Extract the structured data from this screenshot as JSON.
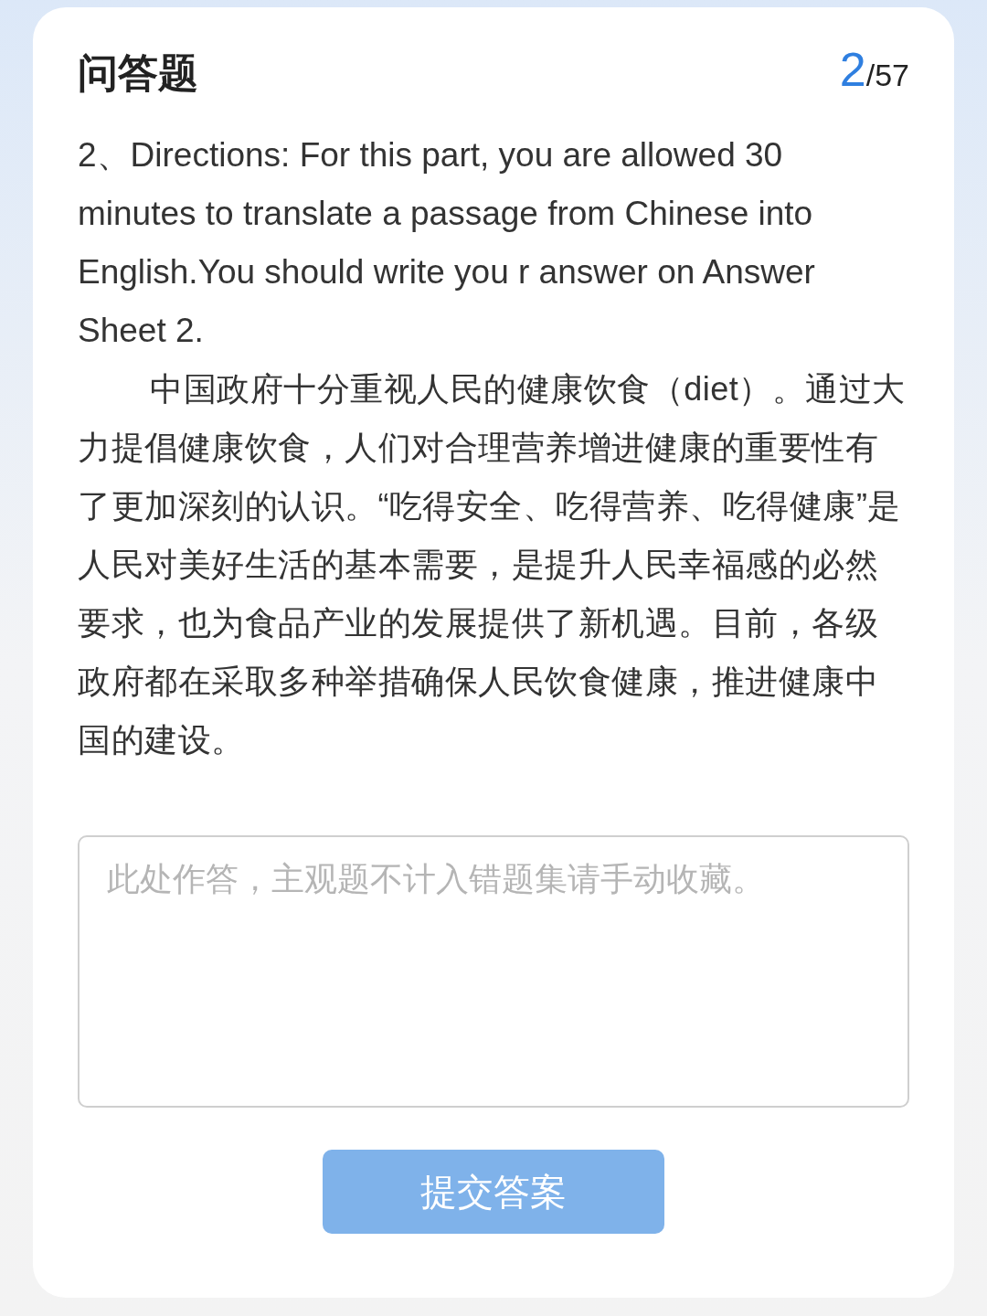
{
  "title": "问答题",
  "counter": {
    "current": "2",
    "total": "/57"
  },
  "question": {
    "paragraphs": [
      {
        "kind": "instruction",
        "text": "2、Directions: For this part, you are allowed 30 minutes to translate a passage from Chinese into English.You should write you r answer on Answer Sheet 2."
      },
      {
        "kind": "passage",
        "text": "中国政府十分重视人民的健康饮食（diet）。通过大力提倡健康饮食，人们对合理营养增进健康的重要性有了更加深刻的认识。“吃得安全、吃得营养、吃得健康”是人民对美好生活的基本需要，是提升人民幸福感的必然要求，也为食品产业的发展提供了新机遇。目前，各级政府都在采取多种举措确保人民饮食健康，推进健康中国的建设。"
      }
    ]
  },
  "answer": {
    "placeholder": "此处作答，主观题不计入错题集请手动收藏。"
  },
  "submit_button": {
    "label": "提交答案"
  }
}
